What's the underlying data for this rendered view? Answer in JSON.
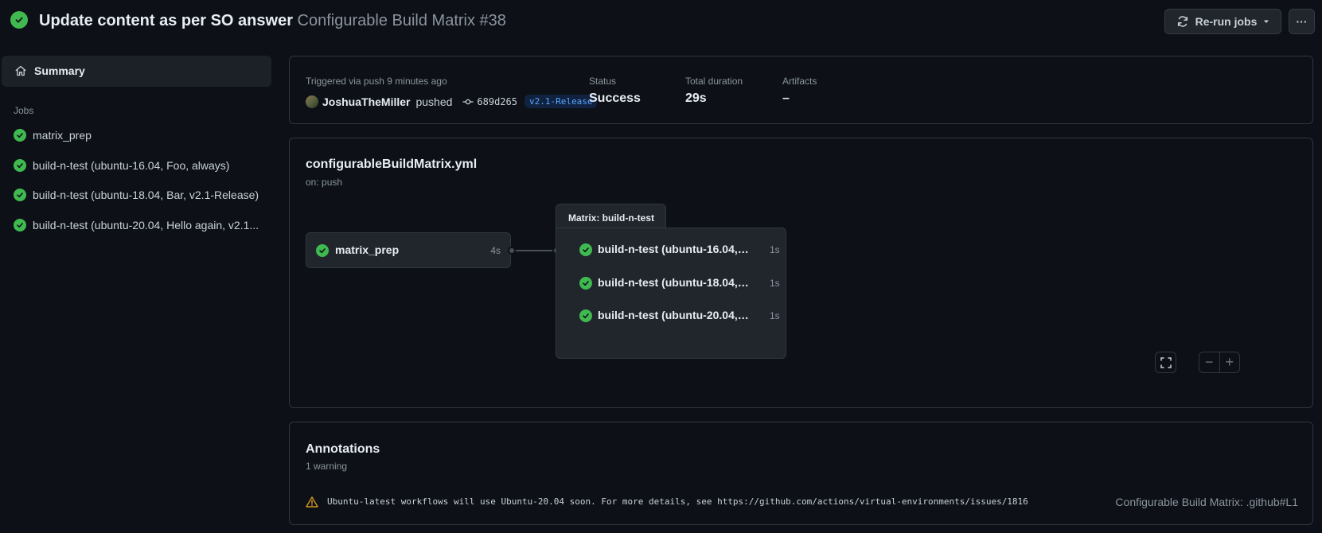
{
  "header": {
    "title": "Update content as per SO answer",
    "workflow_run": "Configurable Build Matrix #38",
    "rerun_label": "Re-run jobs",
    "more_label": "···"
  },
  "sidebar": {
    "summary_label": "Summary",
    "jobs_heading": "Jobs",
    "jobs": [
      {
        "label": "matrix_prep"
      },
      {
        "label": "build-n-test (ubuntu-16.04, Foo, always)"
      },
      {
        "label": "build-n-test (ubuntu-18.04, Bar, v2.1-Release)"
      },
      {
        "label": "build-n-test (ubuntu-20.04, Hello again, v2.1..."
      }
    ]
  },
  "summary": {
    "triggered": "Triggered via push 9 minutes ago",
    "actor": "JoshuaTheMiller",
    "action": "pushed",
    "commit": "689d265",
    "branch": "v2.1-Release",
    "status_label": "Status",
    "status_value": "Success",
    "duration_label": "Total duration",
    "duration_value": "29s",
    "artifacts_label": "Artifacts",
    "artifacts_value": "–"
  },
  "graph": {
    "workflow_file": "configurableBuildMatrix.yml",
    "trigger": "on: push",
    "prep_job": {
      "label": "matrix_prep",
      "duration": "4s"
    },
    "matrix_label": "Matrix: build-n-test",
    "matrix_jobs": [
      {
        "label": "build-n-test (ubuntu-16.04, F...",
        "duration": "1s"
      },
      {
        "label": "build-n-test (ubuntu-18.04, ...",
        "duration": "1s"
      },
      {
        "label": "build-n-test (ubuntu-20.04, ...",
        "duration": "1s"
      }
    ],
    "zoom_out": "−",
    "zoom_in": "+"
  },
  "annotations": {
    "title": "Annotations",
    "count": "1 warning",
    "items": [
      {
        "message": "Ubuntu-latest workflows will use Ubuntu-20.04 soon. For more details, see https://github.com/actions/virtual-environments/issues/1816",
        "source": "Configurable Build Matrix: .github#L1"
      }
    ]
  },
  "colors": {
    "success": "#3fb950",
    "warning": "#d29922",
    "link": "#58a6ff",
    "background": "#0d1117"
  }
}
